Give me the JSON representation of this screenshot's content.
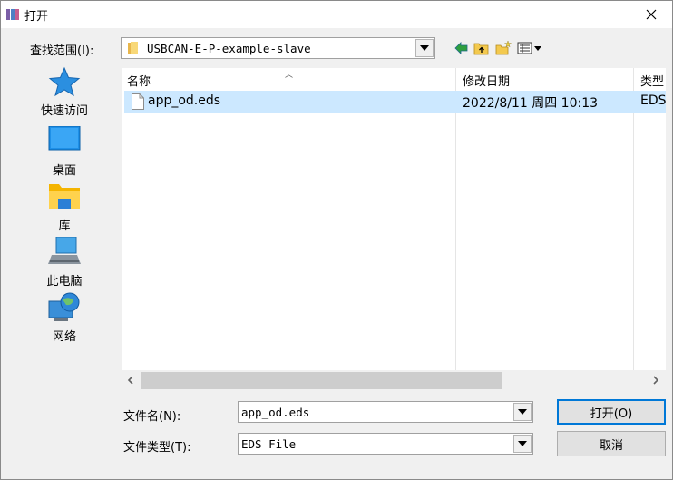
{
  "window": {
    "title": "打开",
    "close_glyph": "✕"
  },
  "lookin": {
    "label": "查找范围(I):",
    "value": "USBCAN-E-P-example-slave"
  },
  "toolbar": {
    "back": "back-icon",
    "up": "up-folder-icon",
    "new_folder": "new-folder-icon",
    "view": "view-menu-icon"
  },
  "places": [
    {
      "label": "快速访问",
      "icon": "star-icon"
    },
    {
      "label": "桌面",
      "icon": "desktop-icon"
    },
    {
      "label": "库",
      "icon": "library-icon"
    },
    {
      "label": "此电脑",
      "icon": "computer-icon"
    },
    {
      "label": "网络",
      "icon": "network-icon"
    }
  ],
  "columns": [
    "名称",
    "修改日期",
    "类型"
  ],
  "files": [
    {
      "name": "app_od.eds",
      "modified": "2022/8/11 周四 10:13",
      "type": "EDS"
    }
  ],
  "filename": {
    "label": "文件名(N):",
    "value": "app_od.eds"
  },
  "filetype": {
    "label": "文件类型(T):",
    "value": "EDS File"
  },
  "buttons": {
    "open": "打开(O)",
    "cancel": "取消"
  },
  "colors": {
    "selection": "#cce8ff",
    "accent": "#0078d7"
  }
}
